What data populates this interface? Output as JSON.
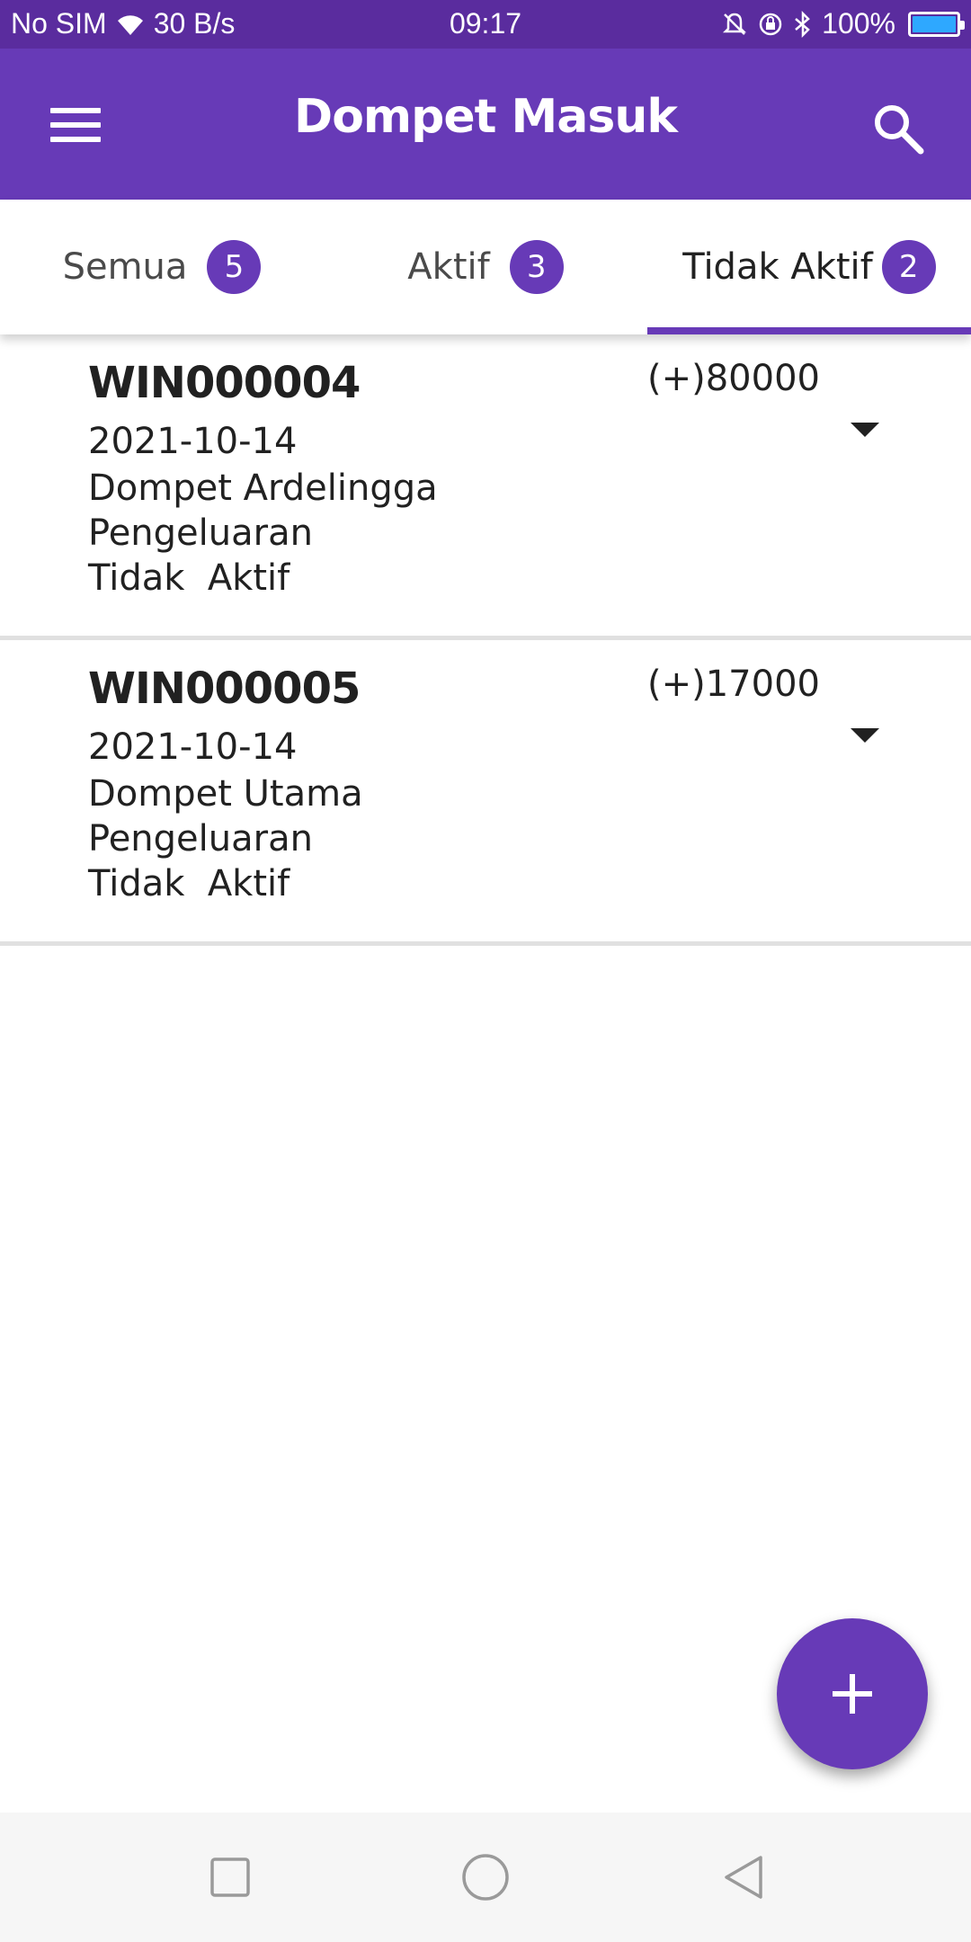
{
  "status_bar": {
    "carrier": "No SIM",
    "net_speed": "30 B/s",
    "time": "09:17",
    "battery_text": "100%",
    "battery_level": 1.0,
    "battery_color": "#2ea8ff"
  },
  "app_bar": {
    "title": "Dompet Masuk",
    "menu_icon": "menu-icon",
    "search_icon": "search-icon",
    "color": "#673ab7"
  },
  "tabs": [
    {
      "label": "Semua",
      "count": "5"
    },
    {
      "label": "Aktif",
      "count": "3"
    },
    {
      "label": "Tidak Aktif",
      "count": "2"
    }
  ],
  "active_tab": "Tidak Aktif",
  "items": [
    {
      "id": "WIN000004",
      "date": "2021-10-14",
      "wallet": "Dompet Ardelingga",
      "type": "Pengeluaran",
      "status": "Tidak  Aktif",
      "amount": "(+)80000"
    },
    {
      "id": "WIN000005",
      "date": "2021-10-14",
      "wallet": "Dompet Utama",
      "type": "Pengeluaran",
      "status": "Tidak  Aktif",
      "amount": "(+)17000"
    }
  ],
  "fab": {
    "icon": "plus-icon"
  },
  "nav_bar": {
    "icons": [
      "recents-icon",
      "home-icon",
      "back-icon"
    ]
  }
}
